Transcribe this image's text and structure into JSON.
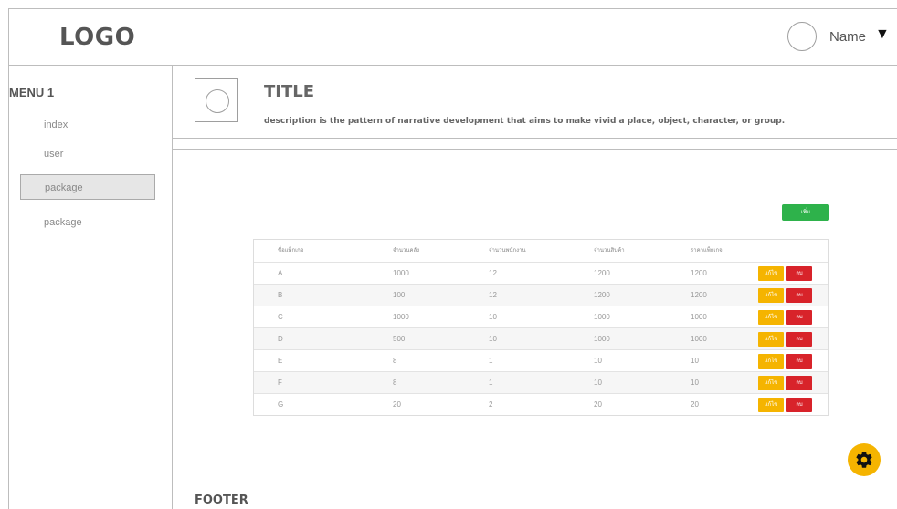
{
  "header": {
    "logo": "LOGO",
    "user_name": "Name",
    "caret": "▼"
  },
  "sidebar": {
    "menu_title": "MENU 1",
    "items": [
      {
        "label": "index",
        "active": false
      },
      {
        "label": "user",
        "active": false
      },
      {
        "label": "package",
        "active": true
      },
      {
        "label": "package",
        "active": false
      }
    ]
  },
  "content": {
    "title": "TITLE",
    "description": "description is the pattern of narrative development that aims to make vivid a place, object, character, or group.",
    "add_label": "เพิ่ม",
    "table": {
      "columns": [
        "ชื่อแพ็กเกจ",
        "จำนวนคลัง",
        "จำนวนพนักงาน",
        "จำนวนสินค้า",
        "ราคาแพ็กเกจ"
      ],
      "edit_label": "แก้ไข",
      "delete_label": "ลบ",
      "rows": [
        [
          "A",
          "1000",
          "12",
          "1200",
          "1200"
        ],
        [
          "B",
          "100",
          "12",
          "1200",
          "1200"
        ],
        [
          "C",
          "1000",
          "10",
          "1000",
          "1000"
        ],
        [
          "D",
          "500",
          "10",
          "1000",
          "1000"
        ],
        [
          "E",
          "8",
          "1",
          "10",
          "10"
        ],
        [
          "F",
          "8",
          "1",
          "10",
          "10"
        ],
        [
          "G",
          "20",
          "2",
          "20",
          "20"
        ]
      ]
    }
  },
  "footer": {
    "label": "FOOTER"
  },
  "colors": {
    "add": "#2eb24b",
    "edit": "#f5b400",
    "delete": "#d8232a",
    "fab": "#f5b400"
  },
  "icons": {
    "settings": "gear-icon",
    "avatar": "avatar-circle",
    "thumbnail": "image-placeholder"
  }
}
